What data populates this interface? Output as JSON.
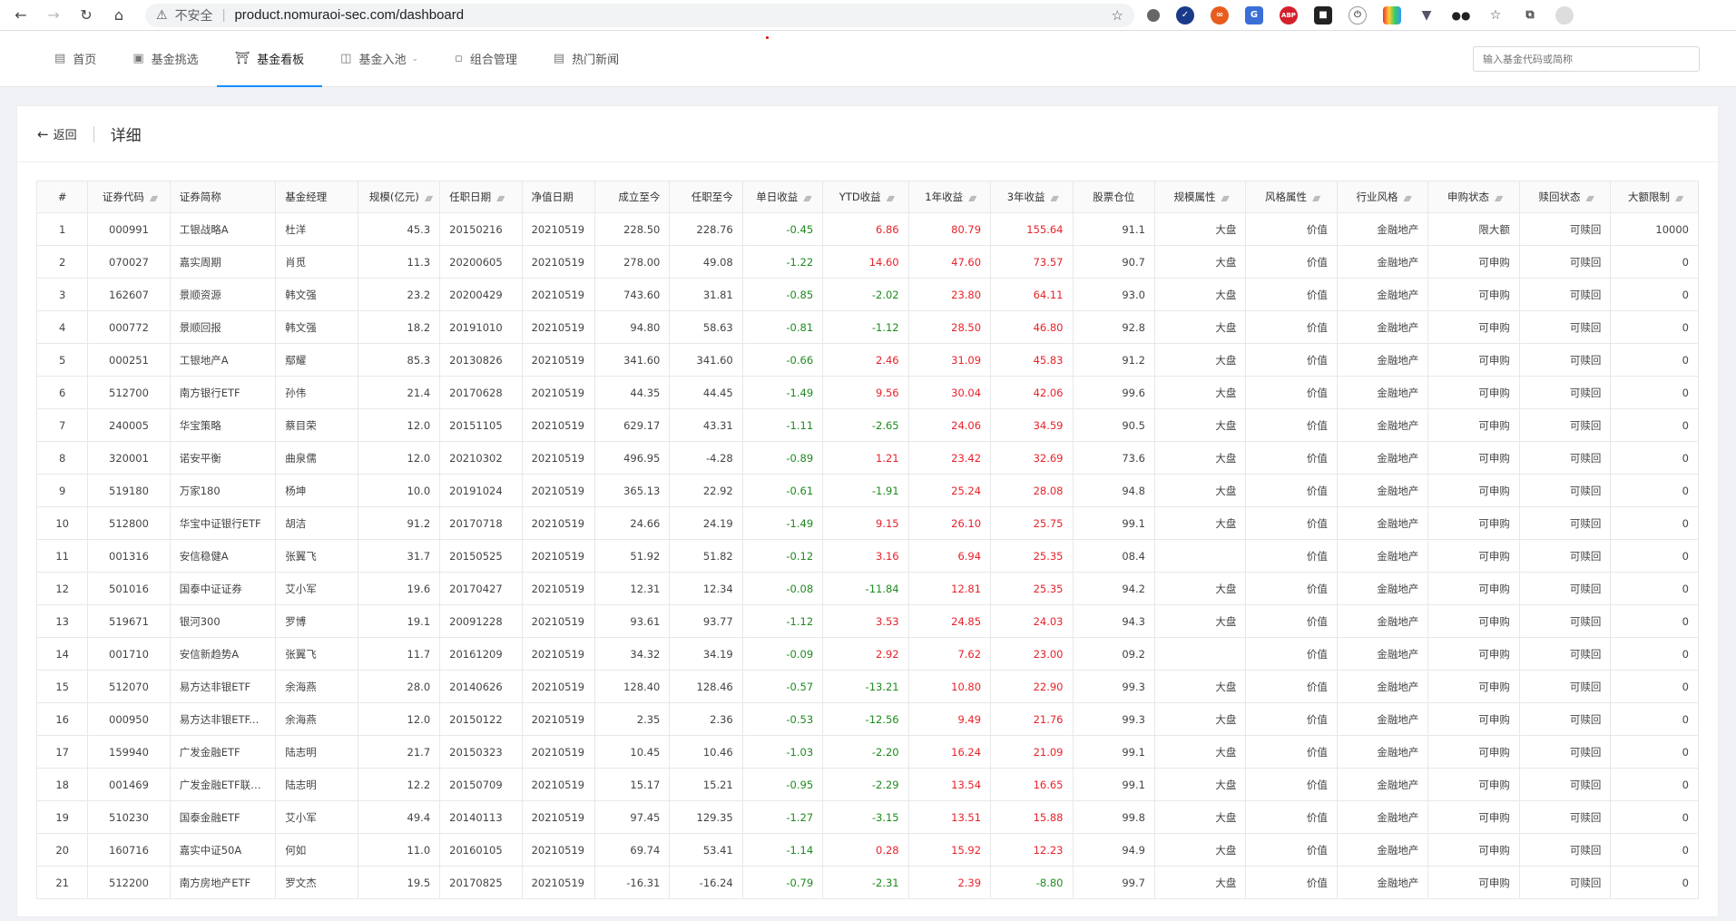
{
  "browser": {
    "insecure_label": "不安全",
    "url": "product.nomuraoi-sec.com/dashboard"
  },
  "nav": {
    "items": [
      {
        "label": "首页",
        "icon": "book-icon"
      },
      {
        "label": "基金挑选",
        "icon": "cart-icon"
      },
      {
        "label": "基金看板",
        "icon": "trophy-icon"
      },
      {
        "label": "基金入池",
        "icon": "box-icon"
      },
      {
        "label": "组合管理",
        "icon": "chart-icon"
      },
      {
        "label": "热门新闻",
        "icon": "news-icon"
      }
    ],
    "active_index": 2,
    "search_placeholder": "输入基金代码或简称"
  },
  "detail": {
    "back_label": "返回",
    "title": "详细"
  },
  "table": {
    "columns": [
      "#",
      "证券代码",
      "证券简称",
      "基金经理",
      "规模(亿元)",
      "任职日期",
      "净值日期",
      "成立至今",
      "任职至今",
      "单日收益",
      "YTD收益",
      "1年收益",
      "3年收益",
      "股票仓位",
      "规模属性",
      "风格属性",
      "行业风格",
      "申购状态",
      "赎回状态",
      "大额限制"
    ],
    "rows": [
      [
        "1",
        "000991",
        "工银战略A",
        "杜洋",
        "45.3",
        "20150216",
        "20210519",
        "228.50",
        "228.76",
        "-0.45",
        "6.86",
        "80.79",
        "155.64",
        "91.1",
        "大盘",
        "价值",
        "金融地产",
        "限大额",
        "可赎回",
        "10000"
      ],
      [
        "2",
        "070027",
        "嘉实周期",
        "肖觅",
        "11.3",
        "20200605",
        "20210519",
        "278.00",
        "49.08",
        "-1.22",
        "14.60",
        "47.60",
        "73.57",
        "90.7",
        "大盘",
        "价值",
        "金融地产",
        "可申购",
        "可赎回",
        "0"
      ],
      [
        "3",
        "162607",
        "景顺资源",
        "韩文强",
        "23.2",
        "20200429",
        "20210519",
        "743.60",
        "31.81",
        "-0.85",
        "-2.02",
        "23.80",
        "64.11",
        "93.0",
        "大盘",
        "价值",
        "金融地产",
        "可申购",
        "可赎回",
        "0"
      ],
      [
        "4",
        "000772",
        "景顺回报",
        "韩文强",
        "18.2",
        "20191010",
        "20210519",
        "94.80",
        "58.63",
        "-0.81",
        "-1.12",
        "28.50",
        "46.80",
        "92.8",
        "大盘",
        "价值",
        "金融地产",
        "可申购",
        "可赎回",
        "0"
      ],
      [
        "5",
        "000251",
        "工银地产A",
        "鄢耀",
        "85.3",
        "20130826",
        "20210519",
        "341.60",
        "341.60",
        "-0.66",
        "2.46",
        "31.09",
        "45.83",
        "91.2",
        "大盘",
        "价值",
        "金融地产",
        "可申购",
        "可赎回",
        "0"
      ],
      [
        "6",
        "512700",
        "南方银行ETF",
        "孙伟",
        "21.4",
        "20170628",
        "20210519",
        "44.35",
        "44.45",
        "-1.49",
        "9.56",
        "30.04",
        "42.06",
        "99.6",
        "大盘",
        "价值",
        "金融地产",
        "可申购",
        "可赎回",
        "0"
      ],
      [
        "7",
        "240005",
        "华宝策略",
        "蔡目荣",
        "12.0",
        "20151105",
        "20210519",
        "629.17",
        "43.31",
        "-1.11",
        "-2.65",
        "24.06",
        "34.59",
        "90.5",
        "大盘",
        "价值",
        "金融地产",
        "可申购",
        "可赎回",
        "0"
      ],
      [
        "8",
        "320001",
        "诺安平衡",
        "曲泉儒",
        "12.0",
        "20210302",
        "20210519",
        "496.95",
        "-4.28",
        "-0.89",
        "1.21",
        "23.42",
        "32.69",
        "73.6",
        "大盘",
        "价值",
        "金融地产",
        "可申购",
        "可赎回",
        "0"
      ],
      [
        "9",
        "519180",
        "万家180",
        "杨坤",
        "10.0",
        "20191024",
        "20210519",
        "365.13",
        "22.92",
        "-0.61",
        "-1.91",
        "25.24",
        "28.08",
        "94.8",
        "大盘",
        "价值",
        "金融地产",
        "可申购",
        "可赎回",
        "0"
      ],
      [
        "10",
        "512800",
        "华宝中证银行ETF",
        "胡洁",
        "91.2",
        "20170718",
        "20210519",
        "24.66",
        "24.19",
        "-1.49",
        "9.15",
        "26.10",
        "25.75",
        "99.1",
        "大盘",
        "价值",
        "金融地产",
        "可申购",
        "可赎回",
        "0"
      ],
      [
        "11",
        "001316",
        "安信稳健A",
        "张翼飞",
        "31.7",
        "20150525",
        "20210519",
        "51.92",
        "51.82",
        "-0.12",
        "3.16",
        "6.94",
        "25.35",
        "08.4",
        "",
        "价值",
        "金融地产",
        "可申购",
        "可赎回",
        "0"
      ],
      [
        "12",
        "501016",
        "国泰中证证券",
        "艾小军",
        "19.6",
        "20170427",
        "20210519",
        "12.31",
        "12.34",
        "-0.08",
        "-11.84",
        "12.81",
        "25.35",
        "94.2",
        "大盘",
        "价值",
        "金融地产",
        "可申购",
        "可赎回",
        "0"
      ],
      [
        "13",
        "519671",
        "银河300",
        "罗博",
        "19.1",
        "20091228",
        "20210519",
        "93.61",
        "93.77",
        "-1.12",
        "3.53",
        "24.85",
        "24.03",
        "94.3",
        "大盘",
        "价值",
        "金融地产",
        "可申购",
        "可赎回",
        "0"
      ],
      [
        "14",
        "001710",
        "安信新趋势A",
        "张翼飞",
        "11.7",
        "20161209",
        "20210519",
        "34.32",
        "34.19",
        "-0.09",
        "2.92",
        "7.62",
        "23.00",
        "09.2",
        "",
        "价值",
        "金融地产",
        "可申购",
        "可赎回",
        "0"
      ],
      [
        "15",
        "512070",
        "易方达非银ETF",
        "余海燕",
        "28.0",
        "20140626",
        "20210519",
        "128.40",
        "128.46",
        "-0.57",
        "-13.21",
        "10.80",
        "22.90",
        "99.3",
        "大盘",
        "价值",
        "金融地产",
        "可申购",
        "可赎回",
        "0"
      ],
      [
        "16",
        "000950",
        "易方达非银ETF...",
        "余海燕",
        "12.0",
        "20150122",
        "20210519",
        "2.35",
        "2.36",
        "-0.53",
        "-12.56",
        "9.49",
        "21.76",
        "99.3",
        "大盘",
        "价值",
        "金融地产",
        "可申购",
        "可赎回",
        "0"
      ],
      [
        "17",
        "159940",
        "广发金融ETF",
        "陆志明",
        "21.7",
        "20150323",
        "20210519",
        "10.45",
        "10.46",
        "-1.03",
        "-2.20",
        "16.24",
        "21.09",
        "99.1",
        "大盘",
        "价值",
        "金融地产",
        "可申购",
        "可赎回",
        "0"
      ],
      [
        "18",
        "001469",
        "广发金融ETF联接A",
        "陆志明",
        "12.2",
        "20150709",
        "20210519",
        "15.17",
        "15.21",
        "-0.95",
        "-2.29",
        "13.54",
        "16.65",
        "99.1",
        "大盘",
        "价值",
        "金融地产",
        "可申购",
        "可赎回",
        "0"
      ],
      [
        "19",
        "510230",
        "国泰金融ETF",
        "艾小军",
        "49.4",
        "20140113",
        "20210519",
        "97.45",
        "129.35",
        "-1.27",
        "-3.15",
        "13.51",
        "15.88",
        "99.8",
        "大盘",
        "价值",
        "金融地产",
        "可申购",
        "可赎回",
        "0"
      ],
      [
        "20",
        "160716",
        "嘉实中证50A",
        "何如",
        "11.0",
        "20160105",
        "20210519",
        "69.74",
        "53.41",
        "-1.14",
        "0.28",
        "15.92",
        "12.23",
        "94.9",
        "大盘",
        "价值",
        "金融地产",
        "可申购",
        "可赎回",
        "0"
      ],
      [
        "21",
        "512200",
        "南方房地产ETF",
        "罗文杰",
        "19.5",
        "20170825",
        "20210519",
        "-16.31",
        "-16.24",
        "-0.79",
        "-2.31",
        "2.39",
        "-8.80",
        "99.7",
        "大盘",
        "价值",
        "金融地产",
        "可申购",
        "可赎回",
        "0"
      ]
    ]
  },
  "colors": {
    "positive": "#e8222a",
    "negative": "#1f8a1f",
    "accent": "#1890ff"
  }
}
